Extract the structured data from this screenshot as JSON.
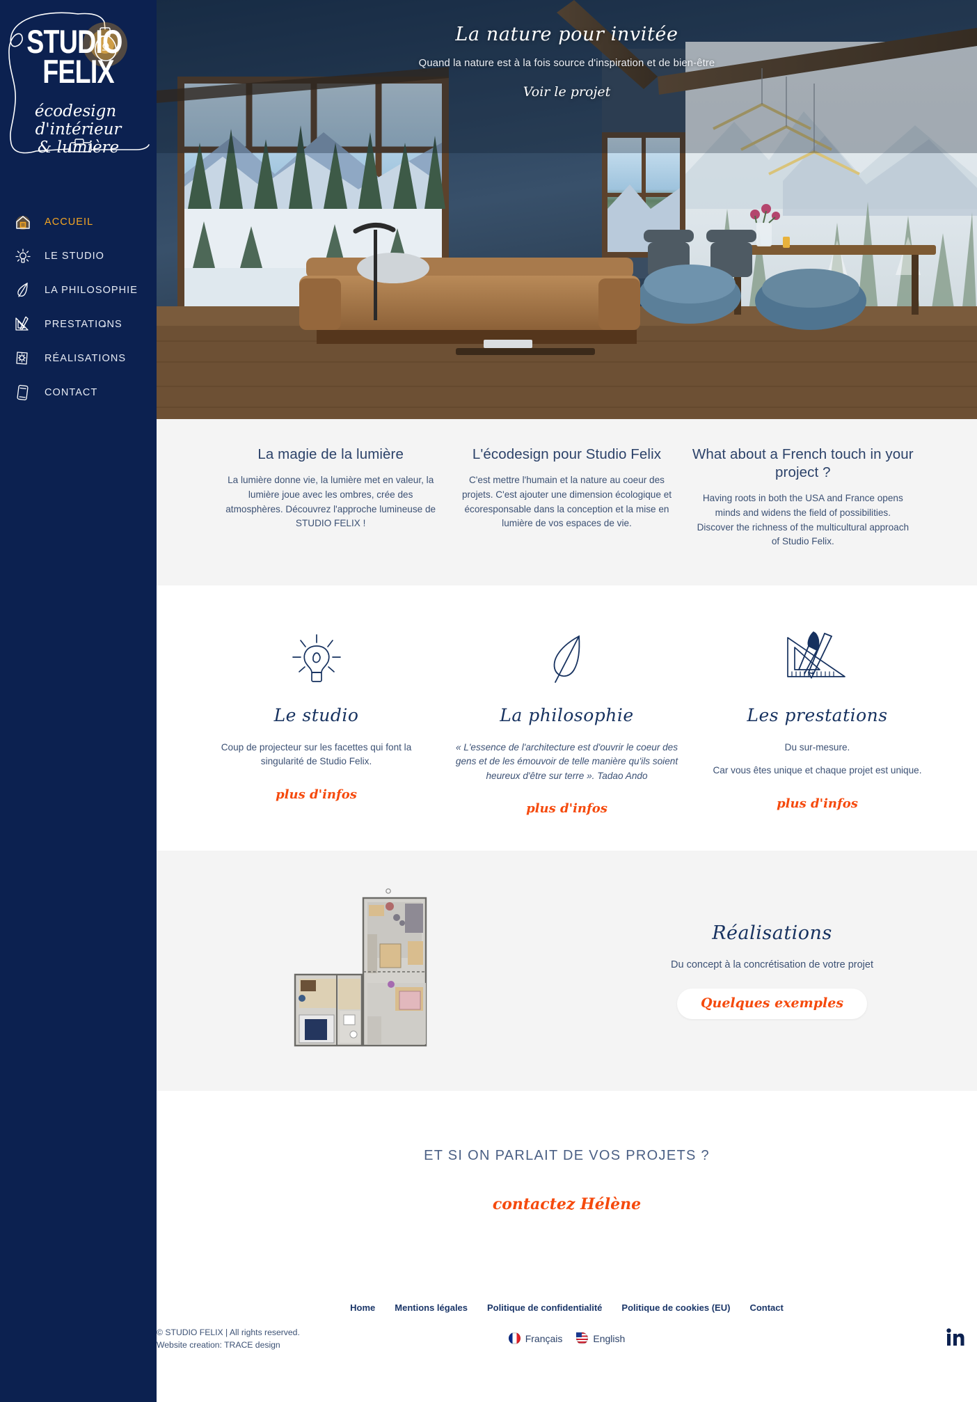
{
  "brand": {
    "name_line1": "STUDIO",
    "name_line2": "FELIX",
    "tagline_line1": "écodesign",
    "tagline_line2": "d'intérieur",
    "tagline_line3": "& lumière"
  },
  "sidebar": {
    "items": [
      {
        "label": "ACCUEIL",
        "icon": "house-icon",
        "active": true,
        "caret": false
      },
      {
        "label": "LE STUDIO",
        "icon": "bulb-icon",
        "active": false,
        "caret": false
      },
      {
        "label": "LA PHILOSOPHIE",
        "icon": "leaf-icon",
        "active": false,
        "caret": false
      },
      {
        "label": "PRESTATIONS",
        "icon": "drafting-icon",
        "active": false,
        "caret": true
      },
      {
        "label": "RÉALISATIONS",
        "icon": "portfolio-icon",
        "active": false,
        "caret": false
      },
      {
        "label": "CONTACT",
        "icon": "phone-icon",
        "active": false,
        "caret": false
      }
    ],
    "caret_glyph": "⌄"
  },
  "hero": {
    "title": "La nature pour invitée",
    "subtitle": "Quand la nature est à la fois source d'inspiration et de bien-être",
    "link": "Voir le projet"
  },
  "intro": {
    "columns": [
      {
        "heading": "La magie de la lumière",
        "body": "La lumière donne vie, la lumière met en valeur, la lumière joue avec les ombres, crée des atmosphères. Découvrez l'approche lumineuse de STUDIO FELIX !"
      },
      {
        "heading": "L'écodesign pour Studio Felix",
        "body": "C'est mettre l'humain et la nature au coeur des projets. C'est ajouter une dimension écologique et écoresponsable dans la conception et la mise en lumière de vos espaces de vie."
      },
      {
        "heading": "What about a French touch in your project ?",
        "body": "Having roots in both the USA and France opens minds and widens the field of possibilities. Discover the richness of the multicultural approach of Studio Felix."
      }
    ]
  },
  "features": {
    "link_label": "plus d'infos",
    "cards": [
      {
        "icon": "lightbulb-sketch-icon",
        "title": "Le studio",
        "paragraphs": [
          "Coup de projecteur sur les facettes qui font la singularité de Studio Felix."
        ],
        "italic": false
      },
      {
        "icon": "leaf-sketch-icon",
        "title": "La philosophie",
        "paragraphs": [
          "« L'essence de l'architecture est d'ouvrir le coeur des gens et de les émouvoir de telle manière qu'ils soient heureux d'être sur terre ». Tadao Ando"
        ],
        "italic": true
      },
      {
        "icon": "set-square-pen-sketch-icon",
        "title": "Les prestations",
        "paragraphs": [
          "Du sur-mesure.",
          "Car vous êtes unique et chaque projet est unique."
        ],
        "italic": false
      }
    ]
  },
  "realisations": {
    "image_alt": "floor-plan",
    "title": "Réalisations",
    "subtitle": "Du concept à la concrétisation de votre projet",
    "button": "Quelques exemples"
  },
  "cta": {
    "heading": "ET SI ON PARLAIT DE VOS PROJETS ?",
    "link": "contactez Hélène"
  },
  "footer": {
    "links": [
      "Home",
      "Mentions légales",
      "Politique de confidentialité",
      "Politique de cookies (EU)",
      "Contact"
    ],
    "languages": [
      {
        "label": "Français",
        "flag": "fr"
      },
      {
        "label": "English",
        "flag": "us"
      }
    ],
    "legal_line1": "© STUDIO FELIX | All rights reserved.",
    "legal_line2": "Website creation: TRACE design",
    "social": "linkedin-icon"
  },
  "colors": {
    "navy": "#0c2150",
    "navy_text": "#16315f",
    "orange": "#f54a0d",
    "amber": "#f5a623",
    "grey_bg": "#f4f4f4"
  }
}
